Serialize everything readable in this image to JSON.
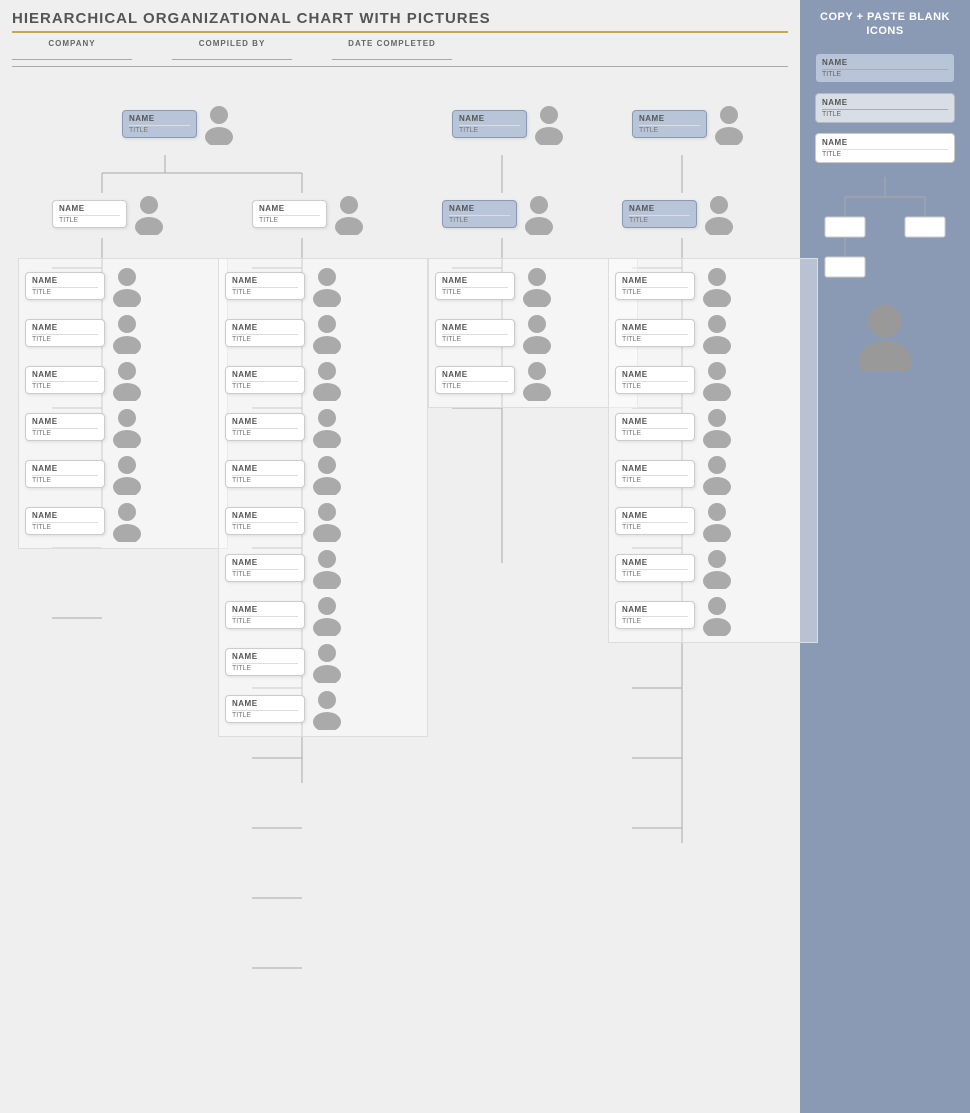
{
  "title": "HIERARCHICAL ORGANIZATIONAL CHART WITH PICTURES",
  "header": {
    "company_label": "COMPANY",
    "compiled_by_label": "COMPILED BY",
    "date_label": "DATE COMPLETED"
  },
  "right_panel": {
    "title": "COPY + PASTE BLANK ICONS",
    "items": [
      {
        "name": "NAME",
        "title": "TITLE"
      },
      {
        "name": "NAME",
        "title": "TITLE"
      },
      {
        "name": "NAME",
        "title": "TITLE"
      }
    ]
  },
  "node_labels": {
    "name": "NAME",
    "title": "TITLE"
  }
}
